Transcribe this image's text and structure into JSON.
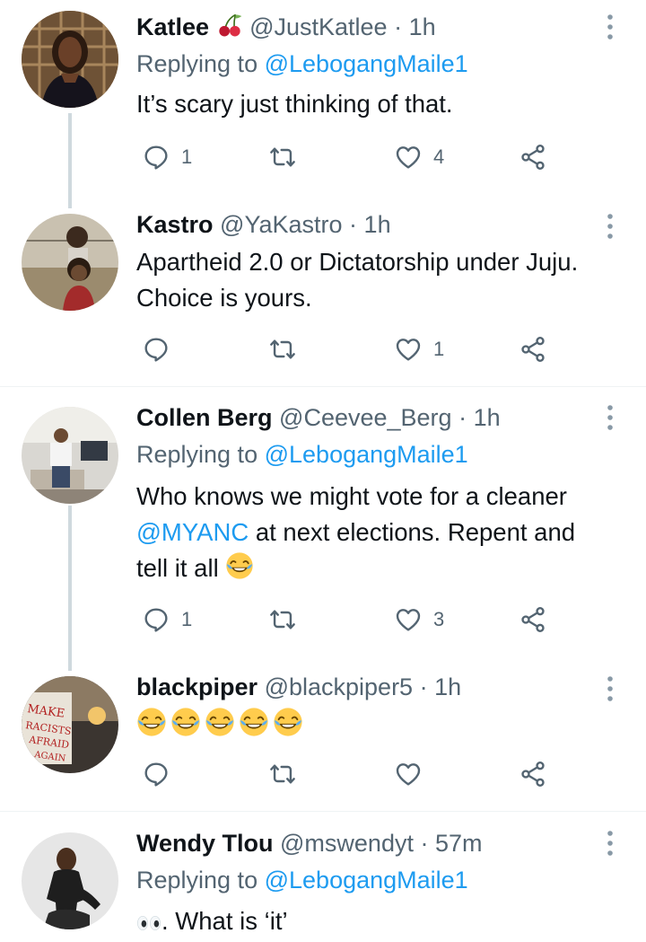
{
  "colors": {
    "accent": "#1d9bf0",
    "muted": "#536471",
    "text": "#0f1419",
    "thread": "#cfd9de"
  },
  "icons": [
    "reply-icon",
    "retweet-icon",
    "like-icon",
    "share-icon",
    "more-icon",
    "cherry-icon",
    "laughing-emoji",
    "eyes-emoji"
  ],
  "tweets": [
    {
      "name": "Katlee",
      "handle": "@JustKatlee",
      "dot": "·",
      "time": "1h",
      "replying_prefix": "Replying to",
      "replying_to": "@LebogangMaile1",
      "text": "It’s scary just thinking of that.",
      "replies": "1",
      "likes": "4"
    },
    {
      "name": "Kastro",
      "handle": "@YaKastro",
      "dot": "·",
      "time": "1h",
      "text_line1": "Apartheid 2.0 or Dictatorship under Juju.",
      "text_line2": "Choice is yours.",
      "likes": "1"
    },
    {
      "name": "Collen Berg",
      "handle": "@Ceevee_Berg",
      "dot": "·",
      "time": "1h",
      "replying_prefix": "Replying to",
      "replying_to": "@LebogangMaile1",
      "text_line1": "Who knows we might vote for a cleaner",
      "text_mention": "@MYANC",
      "text_line2_rest": " at next elections. Repent and",
      "text_line3": "tell it all",
      "replies": "1",
      "likes": "3"
    },
    {
      "name": "blackpiper",
      "handle": "@blackpiper5",
      "dot": "·",
      "time": "1h"
    },
    {
      "name": "Wendy Tlou",
      "handle": "@mswendyt",
      "dot": "·",
      "time": "57m",
      "replying_prefix": "Replying to",
      "replying_to": "@LebogangMaile1",
      "text": ". What is ‘it’"
    }
  ]
}
